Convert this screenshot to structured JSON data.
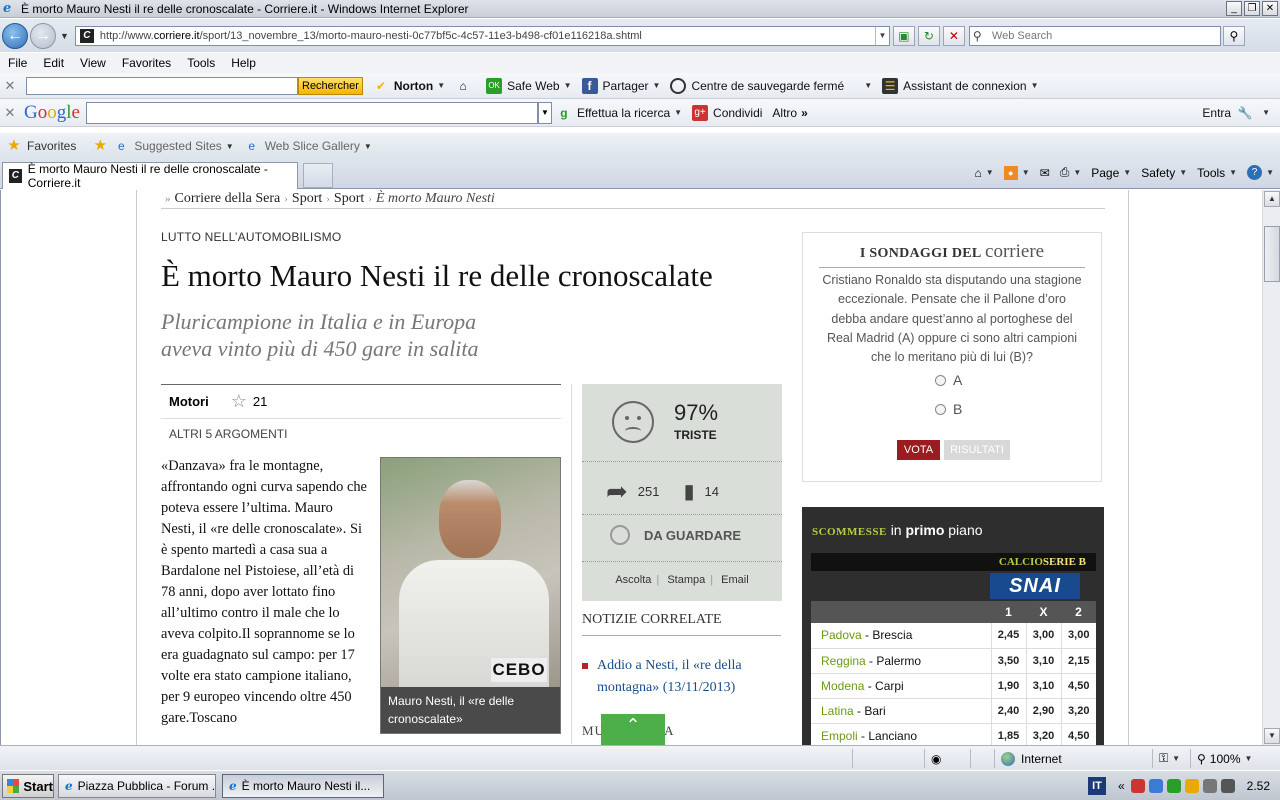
{
  "window": {
    "title": "È morto Mauro Nesti il re delle cronoscalate - Corriere.it - Windows Internet Explorer",
    "controls": [
      "_",
      "❐",
      "✕"
    ]
  },
  "address": {
    "url_prefix": "http://www.",
    "url_domain": "corriere.it",
    "url_path": "/sport/13_novembre_13/morto-mauro-nesti-0c77bf5c-4c57-11e3-b498-cf01e116218a.shtml",
    "search_placeholder": "Web Search"
  },
  "menu": [
    "File",
    "Edit",
    "View",
    "Favorites",
    "Tools",
    "Help"
  ],
  "norton_toolbar": {
    "search_button": "Rechercher",
    "norton": "Norton",
    "safe_web": "Safe Web",
    "share": "Partager",
    "backup": "Centre de sauvegarde fermé",
    "login_assistant": "Assistant de connexion"
  },
  "google_toolbar": {
    "logo": [
      "G",
      "o",
      "o",
      "g",
      "l",
      "e"
    ],
    "search": "Effettua la ricerca",
    "share": "Condividi",
    "more": "Altro",
    "signin": "Entra"
  },
  "favorites_bar": {
    "favorites": "Favorites",
    "suggested": "Suggested Sites",
    "web_slice": "Web Slice Gallery"
  },
  "tab": {
    "title": "È morto Mauro Nesti il re delle cronoscalate - Corriere.it"
  },
  "command_bar": {
    "page": "Page",
    "safety": "Safety",
    "tools": "Tools"
  },
  "breadcrumb": [
    "Corriere della Sera",
    "Sport",
    "Sport",
    "È morto Mauro Nesti"
  ],
  "article": {
    "kicker": "LUTTO NELL’AUTOMOBILISMO",
    "headline": "È morto Mauro Nesti il re delle cronoscalate",
    "subtitle_line1": "Pluricampione in Italia e in Europa",
    "subtitle_line2": "aveva vinto più di 450 gare in salita",
    "category": "Motori",
    "stars": "21",
    "other_topics": "ALTRI 5 ARGOMENTI",
    "body": "«Danzava» fra le montagne, affrontando ogni curva sapendo che poteva essere l’ultima. Mauro Nesti, il «re delle cronoscalate». Si è spento martedì a casa sua a Bardalone nel Pistoiese, all’età di 78 anni, dopo aver lottato fino all’ultimo contro il male che lo aveva colpito.Il soprannome se lo era guadagnato sul campo: per 17 volte era stato campione italiano, per 9 europeo vincendo oltre 450 gare.Toscano",
    "photo_caption": "Mauro Nesti, il «re delle cronoscalate»",
    "photo_suit_logo": "CEBO"
  },
  "mood": {
    "percent": "97%",
    "label": "TRISTE",
    "shares": "251",
    "comments": "14",
    "watch": "DA GUARDARE",
    "links": [
      "Ascolta",
      "Stampa",
      "Email"
    ]
  },
  "related": {
    "heading": "NOTIZIE CORRELATE",
    "item": "Addio a Nesti, il «re della montagna» (13/11/2013)",
    "next_heading": "MULTIMEDIA"
  },
  "poll": {
    "heading_a": "I SONDAGGI DEL",
    "heading_b": "corriere",
    "question": "Cristiano Ronaldo sta disputando una stagione eccezionale. Pensate che il Pallone d’oro debba andare quest’anno al portoghese del Real Madrid (A) oppure ci sono altri campioni che lo meritano più di lui (B)?",
    "options": [
      "A",
      "B"
    ],
    "vote": "VOTA",
    "results": "RISULTATI"
  },
  "bets": {
    "heading_small": "SCOMMESSE",
    "heading_in": "in",
    "heading_bold": "primo",
    "heading_end": "piano",
    "league_a": "CALCIO",
    "league_b": "SERIE B",
    "sponsor": "SNAI",
    "columns": [
      "1",
      "X",
      "2"
    ],
    "rows": [
      {
        "home": "Padova",
        "away": "Brescia",
        "o1": "2,45",
        "ox": "3,00",
        "o2": "3,00"
      },
      {
        "home": "Reggina",
        "away": "Palermo",
        "o1": "3,50",
        "ox": "3,10",
        "o2": "2,15"
      },
      {
        "home": "Modena",
        "away": "Carpi",
        "o1": "1,90",
        "ox": "3,10",
        "o2": "4,50"
      },
      {
        "home": "Latina",
        "away": "Bari",
        "o1": "2,40",
        "ox": "2,90",
        "o2": "3,20"
      },
      {
        "home": "Empoli",
        "away": "Lanciano",
        "o1": "1,85",
        "ox": "3,20",
        "o2": "4,50"
      }
    ]
  },
  "status": {
    "zone": "Internet",
    "zoom": "100%"
  },
  "taskbar": {
    "start": "Start",
    "items": [
      "Piazza Pubblica - Forum ...",
      "È morto Mauro Nesti il..."
    ],
    "lang": "IT",
    "clock": "2.52"
  }
}
